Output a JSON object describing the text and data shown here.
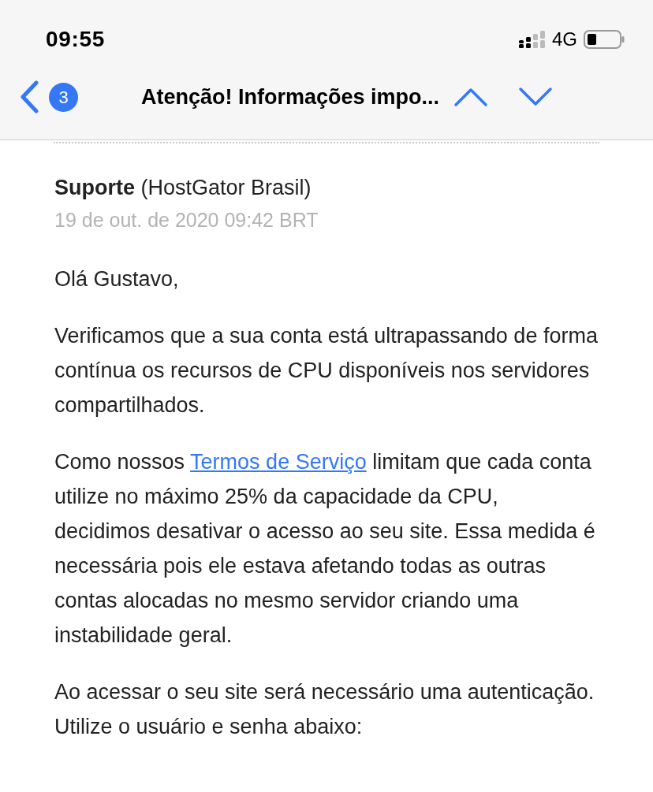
{
  "status_bar": {
    "time": "09:55",
    "network": "4G"
  },
  "nav_bar": {
    "back_badge": "3",
    "title": "Atenção! Informações impo..."
  },
  "message": {
    "sender_name": "Suporte",
    "sender_org": "(HostGator Brasil)",
    "date": "19 de out. de 2020 09:42 BRT",
    "greeting": "Olá Gustavo,",
    "paragraphs": [
      {
        "kind": "text",
        "text": "Verificamos que a sua conta está ultrapassando de forma contínua os recursos de CPU disponíveis nos servidores compartilhados."
      },
      {
        "kind": "link",
        "before": "Como nossos ",
        "link": "Termos de Serviço",
        "after": " limitam que cada conta utilize no máximo 25% da capacidade da CPU, decidimos desativar o acesso ao seu site. Essa medida é necessária pois ele estava afetando todas as outras contas alocadas no mesmo servidor criando uma instabilidade geral."
      },
      {
        "kind": "text",
        "text": "Ao acessar o seu site será necessário uma autenticação. Utilize o usuário e senha abaixo:"
      }
    ]
  }
}
